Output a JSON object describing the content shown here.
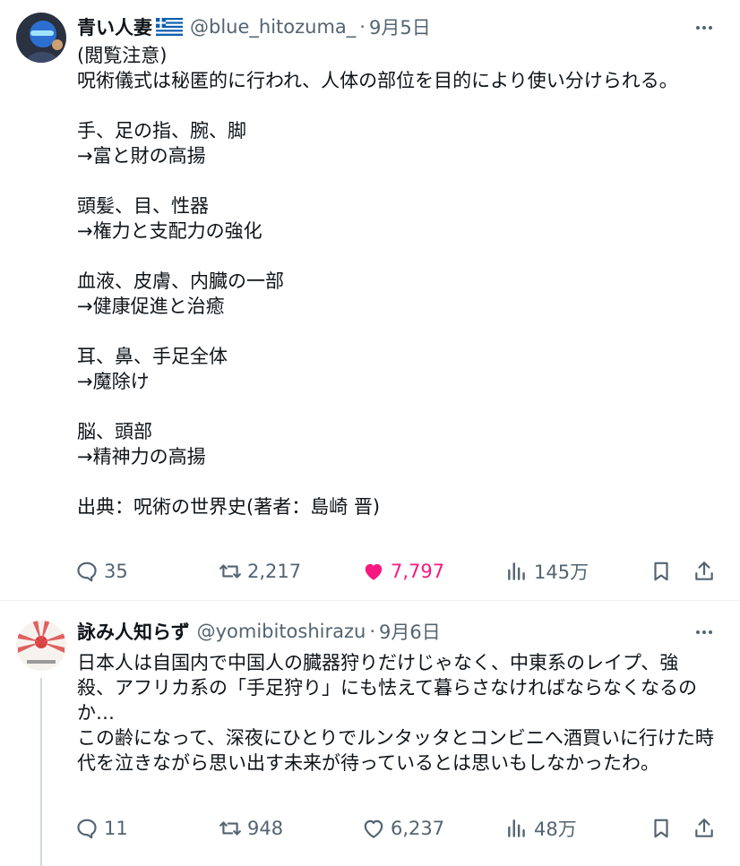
{
  "tweets": [
    {
      "display_name": "青い人妻",
      "flag": "greek-flag",
      "handle": "@blue_hitozuma_",
      "separator": "·",
      "time": "9月5日",
      "text": "(閲覧注意)\n呪術儀式は秘匿的に行われ、人体の部位を目的により使い分けられる。\n\n手、足の指、腕、脚\n→富と財の高揚\n\n頭髪、目、性器\n→権力と支配力の強化\n\n血液、皮膚、内臓の一部\n→健康促進と治癒\n\n耳、鼻、手足全体\n→魔除け\n\n脳、頭部\n→精神力の高揚\n\n出典：呪術の世界史(著者：島崎 晋)",
      "replies": "35",
      "reposts": "2,217",
      "likes": "7,797",
      "liked": true,
      "views": "145万"
    },
    {
      "display_name": "詠み人知らず",
      "handle": "@yomibitoshirazu",
      "separator": "·",
      "time": "9月6日",
      "text": "日本人は自国内で中国人の臓器狩りだけじゃなく、中東系のレイプ、強殺、アフリカ系の「手足狩り」にも怯えて暮らさなければならなくなるのか…\nこの齢になって、深夜にひとりでルンタッタとコンビニへ酒買いに行けた時代を泣きながら思い出す未来が待っているとは思いもしなかったわ。",
      "replies": "11",
      "reposts": "948",
      "likes": "6,237",
      "liked": false,
      "views": "48万"
    }
  ],
  "colors": {
    "text": "#0f1419",
    "secondary": "#536471",
    "like": "#f91880",
    "divider": "#eff3f4"
  }
}
